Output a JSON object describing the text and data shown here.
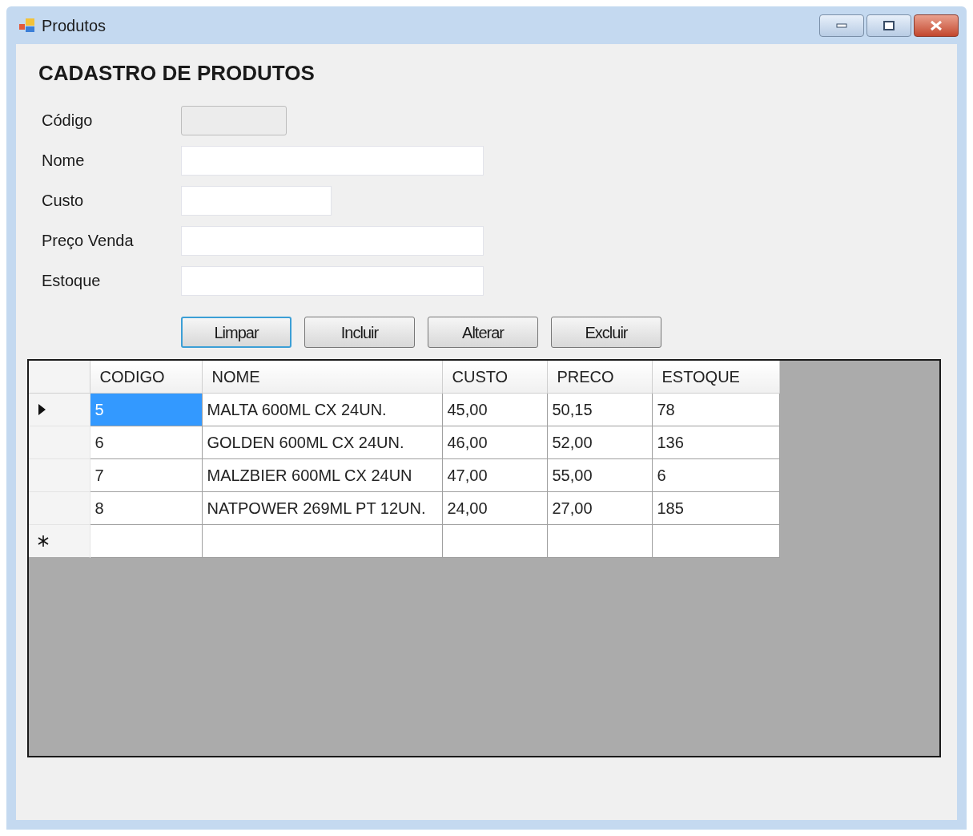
{
  "window": {
    "title": "Produtos"
  },
  "heading": "CADASTRO DE PRODUTOS",
  "fields": [
    {
      "label": "Código",
      "disabled": true
    },
    {
      "label": "Nome",
      "disabled": false
    },
    {
      "label": "Custo",
      "disabled": false
    },
    {
      "label": "Preço Venda",
      "disabled": false
    },
    {
      "label": "Estoque",
      "disabled": false
    }
  ],
  "buttons": [
    {
      "label": "Limpar",
      "focused": true
    },
    {
      "label": "Incluir",
      "focused": false
    },
    {
      "label": "Alterar",
      "focused": false
    },
    {
      "label": "Excluir",
      "focused": false
    }
  ],
  "grid": {
    "columns": [
      "CODIGO",
      "NOME",
      "CUSTO",
      "PRECO",
      "ESTOQUE"
    ],
    "rows": [
      {
        "cells": [
          "5",
          "MALTA 600ML CX 24UN.",
          "45,00",
          "50,15",
          "78"
        ],
        "selected": true
      },
      {
        "cells": [
          "6",
          "GOLDEN 600ML CX 24UN.",
          "46,00",
          "52,00",
          "136"
        ],
        "selected": false
      },
      {
        "cells": [
          "7",
          "MALZBIER 600ML CX 24UN",
          "47,00",
          "55,00",
          "6"
        ],
        "selected": false
      },
      {
        "cells": [
          "8",
          "NATPOWER 269ML PT 12UN.",
          "24,00",
          "27,00",
          "185"
        ],
        "selected": false
      }
    ],
    "new_row": true
  }
}
